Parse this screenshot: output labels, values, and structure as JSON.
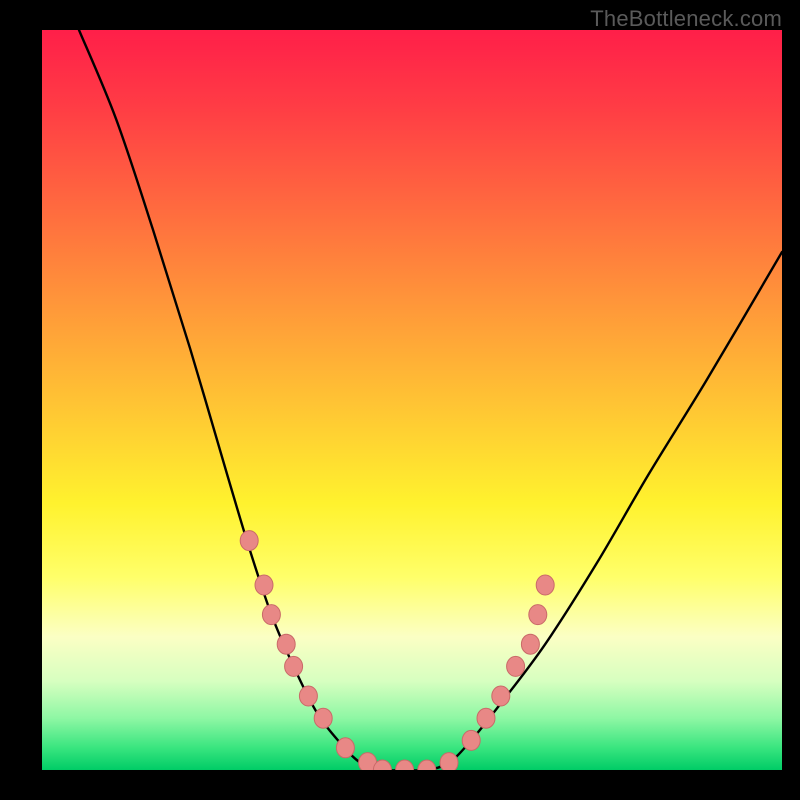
{
  "attribution": "TheBottleneck.com",
  "colors": {
    "frame": "#000000",
    "curve": "#000000",
    "dot_fill": "#e88886",
    "dot_stroke": "#c96a68"
  },
  "chart_data": {
    "type": "line",
    "title": "",
    "xlabel": "",
    "ylabel": "",
    "xlim": [
      0,
      100
    ],
    "ylim": [
      0,
      100
    ],
    "grid": false,
    "legend": false,
    "series": [
      {
        "name": "bottleneck-curve",
        "x": [
          5,
          10,
          15,
          20,
          25,
          28,
          31,
          34,
          37,
          40,
          43,
          46,
          49,
          52,
          55,
          58,
          62,
          68,
          75,
          82,
          90,
          100
        ],
        "y": [
          100,
          88,
          73,
          57,
          40,
          30,
          21,
          14,
          8,
          4,
          1,
          0,
          0,
          0,
          1,
          4,
          9,
          17,
          28,
          40,
          53,
          70
        ]
      }
    ],
    "points": [
      {
        "name": "left-cluster",
        "x": 28,
        "y": 31
      },
      {
        "name": "left-cluster",
        "x": 30,
        "y": 25
      },
      {
        "name": "left-cluster",
        "x": 31,
        "y": 21
      },
      {
        "name": "left-cluster",
        "x": 33,
        "y": 17
      },
      {
        "name": "left-cluster",
        "x": 34,
        "y": 14
      },
      {
        "name": "left-cluster",
        "x": 36,
        "y": 10
      },
      {
        "name": "left-cluster",
        "x": 38,
        "y": 7
      },
      {
        "name": "valley",
        "x": 41,
        "y": 3
      },
      {
        "name": "valley",
        "x": 44,
        "y": 1
      },
      {
        "name": "valley",
        "x": 46,
        "y": 0
      },
      {
        "name": "valley",
        "x": 49,
        "y": 0
      },
      {
        "name": "valley",
        "x": 52,
        "y": 0
      },
      {
        "name": "valley",
        "x": 55,
        "y": 1
      },
      {
        "name": "right-cluster",
        "x": 58,
        "y": 4
      },
      {
        "name": "right-cluster",
        "x": 60,
        "y": 7
      },
      {
        "name": "right-cluster",
        "x": 62,
        "y": 10
      },
      {
        "name": "right-cluster",
        "x": 64,
        "y": 14
      },
      {
        "name": "right-cluster",
        "x": 66,
        "y": 17
      },
      {
        "name": "right-cluster",
        "x": 67,
        "y": 21
      },
      {
        "name": "right-cluster",
        "x": 68,
        "y": 25
      }
    ]
  }
}
